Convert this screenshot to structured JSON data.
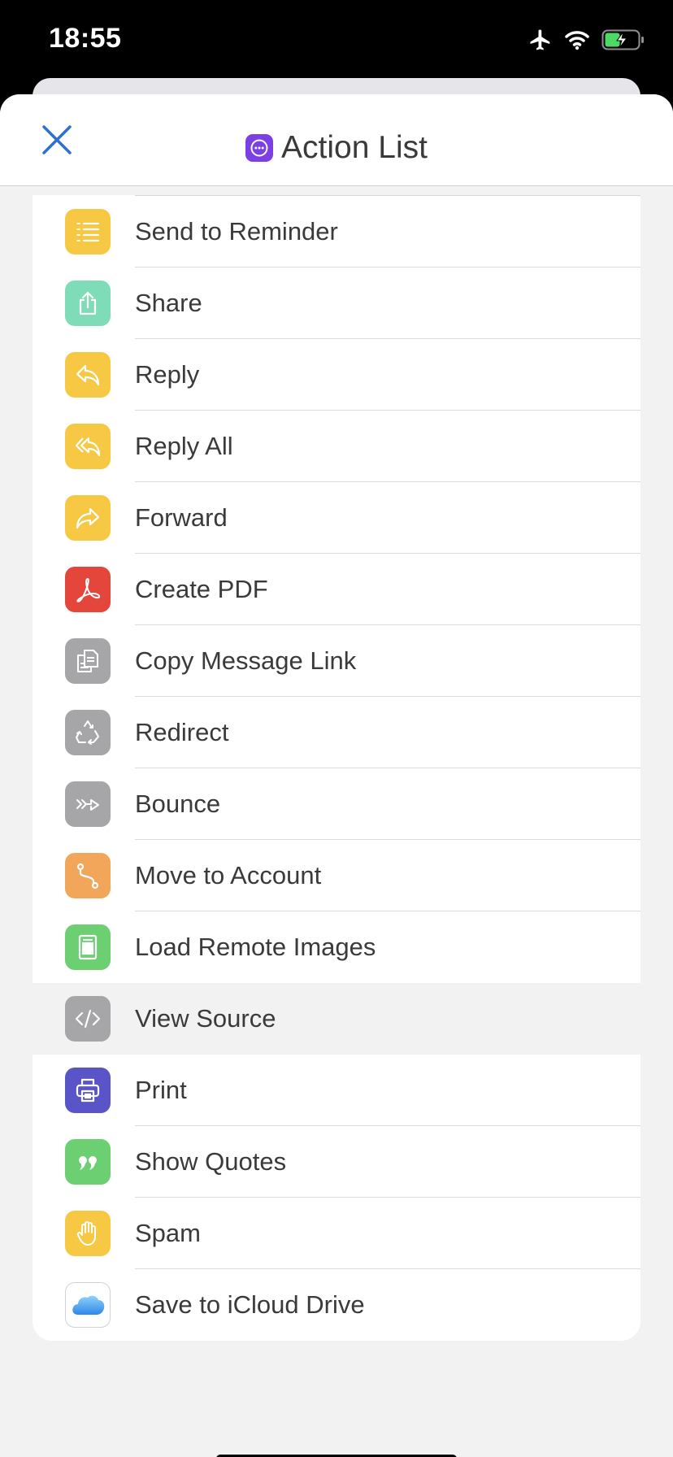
{
  "status": {
    "time": "18:55"
  },
  "header": {
    "title": "Action List",
    "close_icon": "close-icon"
  },
  "colors": {
    "yellow": "#f6c843",
    "teal": "#7fdcb8",
    "red": "#e5463b",
    "gray": "#a6a6a8",
    "orange": "#f2a65a",
    "green": "#6cd073",
    "indigo": "#5a54c9",
    "accent": "#2f6fd0"
  },
  "actions": [
    {
      "label": "Send to Reminder",
      "icon": "list-icon"
    },
    {
      "label": "Share",
      "icon": "share-icon"
    },
    {
      "label": "Reply",
      "icon": "reply-icon"
    },
    {
      "label": "Reply All",
      "icon": "reply-all-icon"
    },
    {
      "label": "Forward",
      "icon": "forward-icon"
    },
    {
      "label": "Create PDF",
      "icon": "pdf-icon"
    },
    {
      "label": "Copy Message Link",
      "icon": "copy-icon"
    },
    {
      "label": "Redirect",
      "icon": "recycle-icon"
    },
    {
      "label": "Bounce",
      "icon": "bounce-icon"
    },
    {
      "label": "Move to Account",
      "icon": "route-icon"
    },
    {
      "label": "Load Remote Images",
      "icon": "image-icon"
    },
    {
      "label": "View Source",
      "icon": "code-icon"
    },
    {
      "label": "Print",
      "icon": "printer-icon"
    },
    {
      "label": "Show Quotes",
      "icon": "quote-icon"
    },
    {
      "label": "Spam",
      "icon": "hand-icon"
    },
    {
      "label": "Save to iCloud Drive",
      "icon": "icloud-icon"
    }
  ]
}
